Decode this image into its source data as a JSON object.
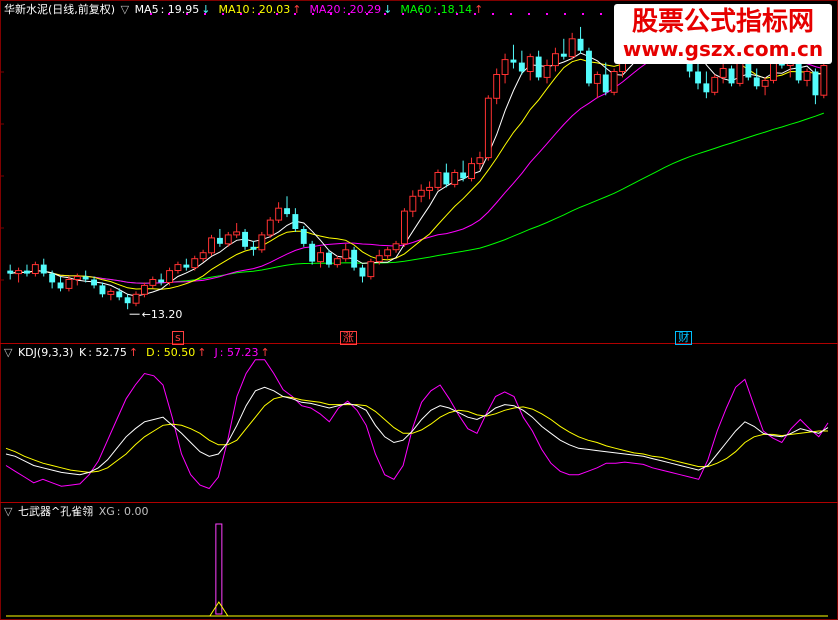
{
  "chart_data": [
    {
      "type": "candlestick",
      "panel": "price",
      "stock": "华新水泥(日线,前复权)",
      "indicators": [
        {
          "name": "MA5",
          "value": "19.95",
          "dir": "↓",
          "color": "#ffffff"
        },
        {
          "name": "MA10",
          "value": "20.03",
          "dir": "↑",
          "color": "#ffff00"
        },
        {
          "name": "MA20",
          "value": "20.29",
          "dir": "↓",
          "color": "#ff00ff"
        },
        {
          "name": "MA60",
          "value": "18.14",
          "dir": "↑",
          "color": "#00ff00"
        }
      ],
      "low_label": "13.20",
      "ylim": [
        12.5,
        23.0
      ],
      "candles": [
        [
          14.5,
          14.7,
          14.2,
          14.4
        ],
        [
          14.4,
          14.6,
          14.1,
          14.5
        ],
        [
          14.5,
          14.7,
          14.3,
          14.4
        ],
        [
          14.4,
          14.8,
          14.3,
          14.7
        ],
        [
          14.7,
          14.9,
          14.3,
          14.4
        ],
        [
          14.4,
          14.5,
          13.9,
          14.1
        ],
        [
          14.1,
          14.3,
          13.8,
          13.9
        ],
        [
          13.9,
          14.3,
          13.8,
          14.2
        ],
        [
          14.2,
          14.4,
          14.0,
          14.3
        ],
        [
          14.3,
          14.5,
          14.1,
          14.2
        ],
        [
          14.2,
          14.3,
          13.9,
          14.0
        ],
        [
          14.0,
          14.1,
          13.6,
          13.7
        ],
        [
          13.7,
          13.9,
          13.5,
          13.8
        ],
        [
          13.8,
          13.9,
          13.5,
          13.6
        ],
        [
          13.6,
          13.7,
          13.2,
          13.4
        ],
        [
          13.4,
          13.8,
          13.3,
          13.7
        ],
        [
          13.7,
          14.1,
          13.6,
          14.0
        ],
        [
          14.0,
          14.3,
          13.9,
          14.2
        ],
        [
          14.2,
          14.4,
          14.0,
          14.1
        ],
        [
          14.1,
          14.6,
          14.0,
          14.5
        ],
        [
          14.5,
          14.8,
          14.4,
          14.7
        ],
        [
          14.7,
          14.9,
          14.5,
          14.6
        ],
        [
          14.6,
          15.0,
          14.5,
          14.9
        ],
        [
          14.9,
          15.2,
          14.8,
          15.1
        ],
        [
          15.1,
          15.7,
          15.0,
          15.6
        ],
        [
          15.6,
          15.9,
          15.3,
          15.4
        ],
        [
          15.4,
          15.8,
          15.3,
          15.7
        ],
        [
          15.7,
          16.1,
          15.6,
          15.8
        ],
        [
          15.8,
          15.9,
          15.2,
          15.3
        ],
        [
          15.3,
          15.5,
          15.0,
          15.2
        ],
        [
          15.2,
          15.8,
          15.1,
          15.7
        ],
        [
          15.7,
          16.3,
          15.6,
          16.2
        ],
        [
          16.2,
          16.8,
          16.1,
          16.6
        ],
        [
          16.6,
          17.0,
          16.3,
          16.4
        ],
        [
          16.4,
          16.6,
          15.8,
          15.9
        ],
        [
          15.9,
          16.0,
          15.3,
          15.4
        ],
        [
          15.4,
          15.5,
          14.7,
          14.8
        ],
        [
          14.8,
          15.3,
          14.6,
          15.1
        ],
        [
          15.1,
          15.2,
          14.6,
          14.7
        ],
        [
          14.7,
          15.0,
          14.6,
          14.9
        ],
        [
          14.9,
          15.4,
          14.8,
          15.2
        ],
        [
          15.2,
          15.3,
          14.5,
          14.6
        ],
        [
          14.6,
          14.7,
          14.1,
          14.3
        ],
        [
          14.3,
          14.9,
          14.2,
          14.8
        ],
        [
          14.8,
          15.2,
          14.7,
          15.0
        ],
        [
          15.0,
          15.3,
          14.9,
          15.2
        ],
        [
          15.2,
          15.5,
          15.1,
          15.4
        ],
        [
          15.4,
          16.6,
          15.3,
          16.5
        ],
        [
          16.5,
          17.2,
          16.3,
          17.0
        ],
        [
          17.0,
          17.4,
          16.8,
          17.2
        ],
        [
          17.2,
          17.5,
          16.9,
          17.3
        ],
        [
          17.3,
          17.9,
          17.2,
          17.8
        ],
        [
          17.8,
          18.1,
          17.3,
          17.4
        ],
        [
          17.4,
          17.9,
          17.3,
          17.8
        ],
        [
          17.8,
          18.2,
          17.5,
          17.6
        ],
        [
          17.6,
          18.3,
          17.5,
          18.1
        ],
        [
          18.1,
          18.5,
          17.9,
          18.3
        ],
        [
          18.3,
          20.4,
          18.2,
          20.3
        ],
        [
          20.3,
          21.3,
          20.1,
          21.1
        ],
        [
          21.1,
          21.8,
          20.8,
          21.6
        ],
        [
          21.6,
          22.1,
          21.3,
          21.5
        ],
        [
          21.5,
          21.9,
          21.1,
          21.2
        ],
        [
          21.2,
          21.8,
          20.9,
          21.7
        ],
        [
          21.7,
          21.9,
          20.9,
          21.0
        ],
        [
          21.0,
          21.6,
          20.8,
          21.4
        ],
        [
          21.4,
          22.0,
          21.2,
          21.8
        ],
        [
          21.8,
          22.3,
          21.6,
          21.7
        ],
        [
          21.7,
          22.5,
          21.6,
          22.3
        ],
        [
          22.3,
          22.7,
          21.8,
          21.9
        ],
        [
          21.9,
          22.0,
          20.7,
          20.8
        ],
        [
          20.8,
          21.2,
          20.3,
          21.1
        ],
        [
          21.1,
          21.5,
          20.4,
          20.5
        ],
        [
          20.5,
          21.3,
          20.4,
          21.2
        ],
        [
          21.2,
          21.9,
          21.0,
          21.8
        ],
        [
          21.8,
          22.4,
          21.6,
          22.3
        ],
        [
          22.3,
          22.8,
          22.1,
          22.6
        ],
        [
          22.6,
          22.9,
          22.2,
          22.4
        ],
        [
          22.4,
          23.0,
          22.3,
          22.9
        ],
        [
          22.9,
          23.2,
          22.7,
          22.8
        ],
        [
          22.8,
          23.1,
          22.5,
          22.6
        ],
        [
          22.6,
          22.7,
          21.9,
          22.0
        ],
        [
          22.0,
          22.1,
          21.0,
          21.2
        ],
        [
          21.2,
          21.5,
          20.6,
          20.8
        ],
        [
          20.8,
          21.2,
          20.3,
          20.5
        ],
        [
          20.5,
          21.1,
          20.4,
          21.0
        ],
        [
          21.0,
          21.5,
          20.8,
          21.3
        ],
        [
          21.3,
          21.4,
          20.7,
          20.8
        ],
        [
          20.8,
          21.6,
          20.7,
          21.5
        ],
        [
          21.5,
          21.7,
          20.9,
          21.0
        ],
        [
          21.0,
          21.3,
          20.6,
          20.7
        ],
        [
          20.7,
          21.0,
          20.4,
          20.9
        ],
        [
          20.9,
          21.8,
          20.8,
          21.7
        ],
        [
          21.7,
          21.9,
          21.3,
          21.4
        ],
        [
          21.4,
          21.8,
          21.0,
          21.7
        ],
        [
          21.7,
          21.8,
          20.8,
          20.9
        ],
        [
          20.9,
          21.3,
          20.7,
          21.2
        ],
        [
          21.2,
          21.3,
          20.1,
          20.4
        ],
        [
          20.4,
          21.5,
          20.3,
          21.4
        ]
      ],
      "events": [
        {
          "label": "s",
          "index": 20,
          "color": "#ff4040"
        },
        {
          "label": "涨",
          "index": 40,
          "color": "#ff4040"
        },
        {
          "label": "财",
          "index": 80,
          "color": "#00c0ff"
        }
      ]
    },
    {
      "type": "line",
      "panel": "kdj",
      "name": "KDJ(9,3,3)",
      "indicators": [
        {
          "name": "K",
          "value": "52.75",
          "dir": "↑",
          "color": "#ffffff"
        },
        {
          "name": "D",
          "value": "50.50",
          "dir": "↑",
          "color": "#ffff00"
        },
        {
          "name": "J",
          "value": "57.23",
          "dir": "↑",
          "color": "#ff00ff"
        }
      ],
      "ylim": [
        -10,
        110
      ],
      "k": [
        30,
        28,
        24,
        20,
        18,
        16,
        14,
        13,
        12,
        14,
        18,
        25,
        35,
        45,
        52,
        58,
        60,
        62,
        55,
        48,
        40,
        32,
        28,
        30,
        40,
        55,
        72,
        85,
        88,
        85,
        80,
        78,
        75,
        74,
        72,
        70,
        72,
        74,
        72,
        68,
        55,
        45,
        40,
        42,
        50,
        60,
        68,
        72,
        70,
        66,
        62,
        60,
        64,
        70,
        73,
        72,
        68,
        62,
        54,
        48,
        42,
        38,
        35,
        34,
        33,
        32,
        31,
        30,
        29,
        28,
        26,
        24,
        22,
        20,
        18,
        16,
        20,
        30,
        40,
        50,
        58,
        54,
        48,
        46,
        45,
        48,
        52,
        50,
        48,
        53
      ],
      "d": [
        35,
        32,
        28,
        25,
        22,
        20,
        18,
        16,
        15,
        14,
        15,
        18,
        24,
        30,
        38,
        45,
        50,
        55,
        56,
        55,
        52,
        48,
        42,
        38,
        38,
        42,
        52,
        62,
        72,
        78,
        80,
        79,
        77,
        76,
        75,
        73,
        73,
        73,
        73,
        72,
        67,
        60,
        53,
        48,
        48,
        51,
        56,
        62,
        66,
        68,
        67,
        64,
        63,
        65,
        68,
        70,
        71,
        69,
        65,
        60,
        54,
        49,
        45,
        42,
        40,
        37,
        35,
        33,
        31,
        30,
        28,
        27,
        25,
        23,
        21,
        19,
        19,
        22,
        26,
        32,
        40,
        45,
        47,
        47,
        46,
        47,
        48,
        49,
        50,
        50
      ],
      "j": [
        20,
        15,
        10,
        5,
        8,
        5,
        2,
        3,
        4,
        12,
        24,
        42,
        60,
        78,
        90,
        100,
        98,
        90,
        62,
        30,
        12,
        3,
        0,
        10,
        42,
        80,
        100,
        112,
        112,
        100,
        86,
        80,
        72,
        70,
        65,
        58,
        70,
        76,
        68,
        55,
        30,
        12,
        8,
        20,
        52,
        75,
        85,
        90,
        78,
        64,
        52,
        48,
        65,
        80,
        84,
        80,
        62,
        50,
        34,
        22,
        15,
        12,
        12,
        15,
        18,
        22,
        22,
        23,
        22,
        21,
        18,
        16,
        14,
        12,
        10,
        8,
        25,
        50,
        70,
        88,
        95,
        72,
        50,
        44,
        40,
        52,
        60,
        52,
        45,
        57
      ]
    },
    {
      "type": "line",
      "panel": "xg",
      "name": "七武器^孔雀翎",
      "indicators": [
        {
          "name": "XG",
          "value": "0.00",
          "color": "#c0c0c0"
        }
      ],
      "ylim": [
        0,
        1
      ],
      "signals": [
        25
      ]
    }
  ]
}
